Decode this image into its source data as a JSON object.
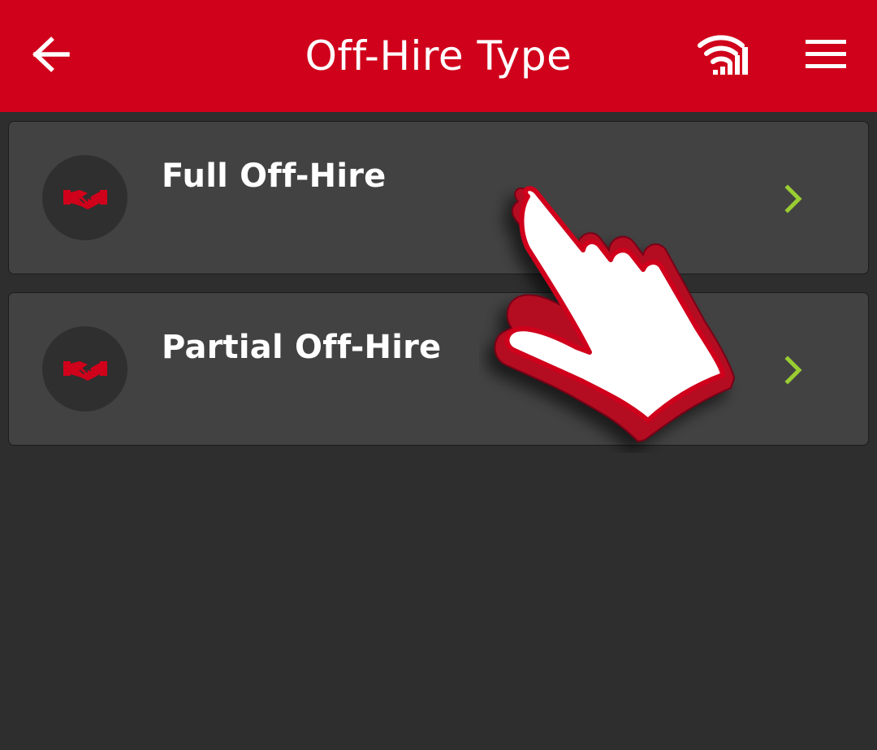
{
  "header": {
    "title": "Off-Hire Type",
    "back_icon": "arrow-left-icon",
    "status_icon": "wifi-signal-icon",
    "menu_icon": "hamburger-menu-icon"
  },
  "items": [
    {
      "label": "Full Off-Hire",
      "icon": "handshake-icon",
      "chevron": "chevron-right-icon"
    },
    {
      "label": "Partial Off-Hire",
      "icon": "handshake-icon",
      "chevron": "chevron-right-icon"
    }
  ],
  "overlay": {
    "pointer_icon": "pointing-hand-icon"
  },
  "colors": {
    "brand_red": "#d0011b",
    "background": "#2e2e2e",
    "card": "#424242",
    "chevron_green": "#9acd32",
    "text": "#ffffff"
  }
}
